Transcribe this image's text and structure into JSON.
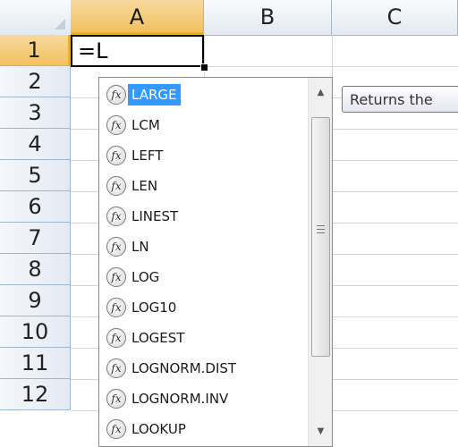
{
  "columns": [
    "A",
    "B",
    "C"
  ],
  "rows": [
    "1",
    "2",
    "3",
    "4",
    "5",
    "6",
    "7",
    "8",
    "9",
    "10",
    "11",
    "12"
  ],
  "active_cell": {
    "column": "A",
    "row": "1",
    "value": "=L"
  },
  "autocomplete": {
    "items": [
      "LARGE",
      "LCM",
      "LEFT",
      "LEN",
      "LINEST",
      "LN",
      "LOG",
      "LOG10",
      "LOGEST",
      "LOGNORM.DIST",
      "LOGNORM.INV",
      "LOOKUP"
    ],
    "selected": "LARGE",
    "icon_glyph": "fx"
  },
  "tooltip": {
    "text": "Returns the"
  },
  "colors": {
    "selected_header": "#f1c15f",
    "highlight": "#3399ff",
    "gridline": "#d4d4d4"
  }
}
